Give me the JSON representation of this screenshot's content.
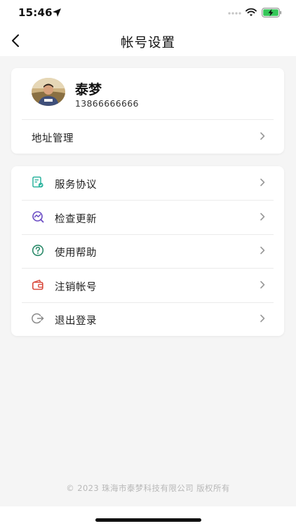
{
  "status_bar": {
    "time": "15:46",
    "icons": [
      "location-arrow-icon",
      "signal-icon",
      "wifi-icon",
      "battery-charging-icon"
    ]
  },
  "nav": {
    "title": "帐号设置",
    "back_icon": "chevron-left-icon"
  },
  "profile": {
    "name": "泰梦",
    "phone": "13866666666",
    "avatar_icon": "user-avatar-photo"
  },
  "address_row": {
    "label": "地址管理"
  },
  "menu": {
    "items": [
      {
        "label": "服务协议",
        "icon": "document-icon"
      },
      {
        "label": "检查更新",
        "icon": "update-chart-icon"
      },
      {
        "label": "使用帮助",
        "icon": "help-circle-icon"
      },
      {
        "label": "注销帐号",
        "icon": "wallet-icon"
      },
      {
        "label": "退出登录",
        "icon": "logout-icon"
      }
    ]
  },
  "footer": {
    "text": "© 2023 珠海市泰梦科技有限公司 版权所有"
  },
  "colors": {
    "background": "#f5f5f5",
    "card": "#ffffff",
    "service_icon": "#2bb39e",
    "update_icon": "#6a4bc4",
    "help_icon": "#2b8a6a",
    "cancel_icon": "#d9493b",
    "logout_icon": "#8a8a8a"
  }
}
